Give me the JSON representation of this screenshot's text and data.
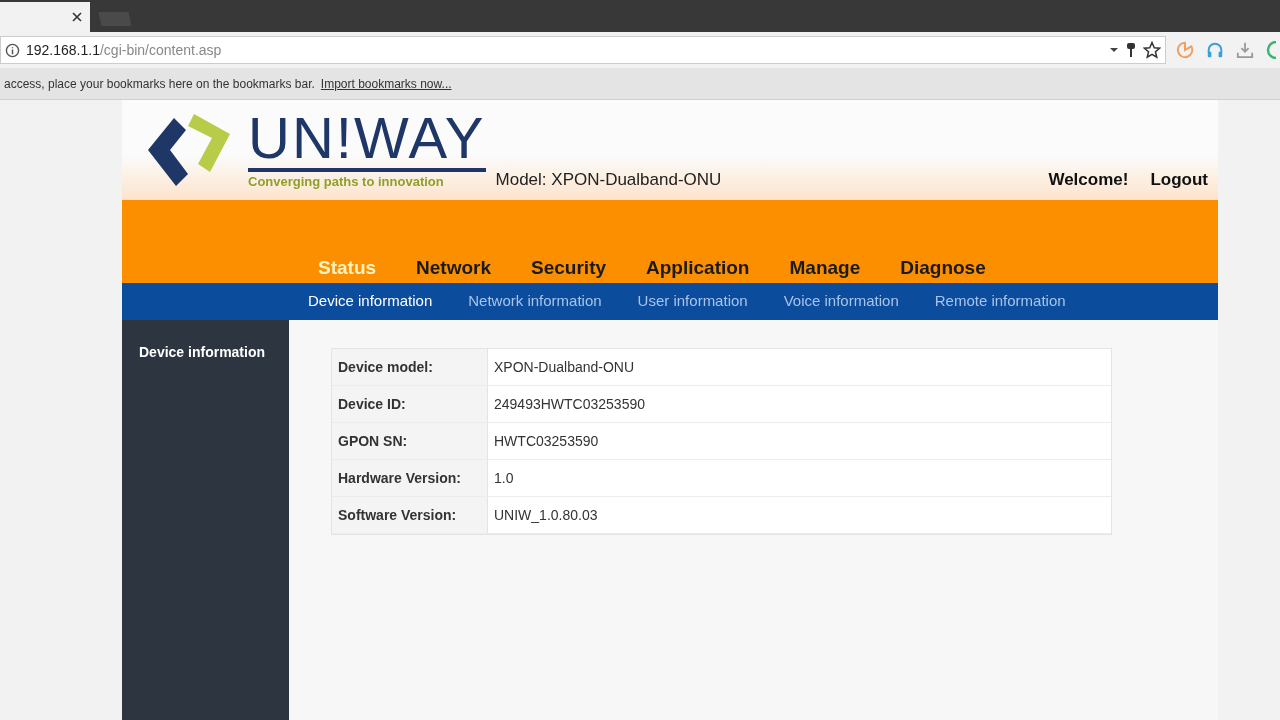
{
  "browser": {
    "address_host": "192.168.1.1",
    "address_path": "/cgi-bin/content.asp",
    "bookmarks_message": "access, place your bookmarks here on the bookmarks bar.",
    "bookmarks_link": "Import bookmarks now..."
  },
  "header": {
    "logo_text": "UN!WAY",
    "tagline": "Converging paths to innovation",
    "model": "Model: XPON-Dualband-ONU",
    "welcome": "Welcome!",
    "logout": "Logout"
  },
  "main_menu": [
    {
      "label": "Status",
      "selected": true
    },
    {
      "label": "Network",
      "selected": false
    },
    {
      "label": "Security",
      "selected": false
    },
    {
      "label": "Application",
      "selected": false
    },
    {
      "label": "Manage",
      "selected": false
    },
    {
      "label": "Diagnose",
      "selected": false
    }
  ],
  "sub_menu": [
    {
      "label": "Device information",
      "selected": true
    },
    {
      "label": "Network information",
      "selected": false
    },
    {
      "label": "User information",
      "selected": false
    },
    {
      "label": "Voice information",
      "selected": false
    },
    {
      "label": "Remote information",
      "selected": false
    }
  ],
  "sidebar": {
    "items": [
      {
        "label": "Device information",
        "selected": true
      }
    ]
  },
  "device_info": [
    {
      "label": "Device model:",
      "value": "XPON-Dualband-ONU"
    },
    {
      "label": "Device ID:",
      "value": "249493HWTC03253590"
    },
    {
      "label": "GPON SN:",
      "value": "HWTC03253590"
    },
    {
      "label": "Hardware Version:",
      "value": "1.0"
    },
    {
      "label": "Software Version:",
      "value": "UNIW_1.0.80.03"
    }
  ]
}
